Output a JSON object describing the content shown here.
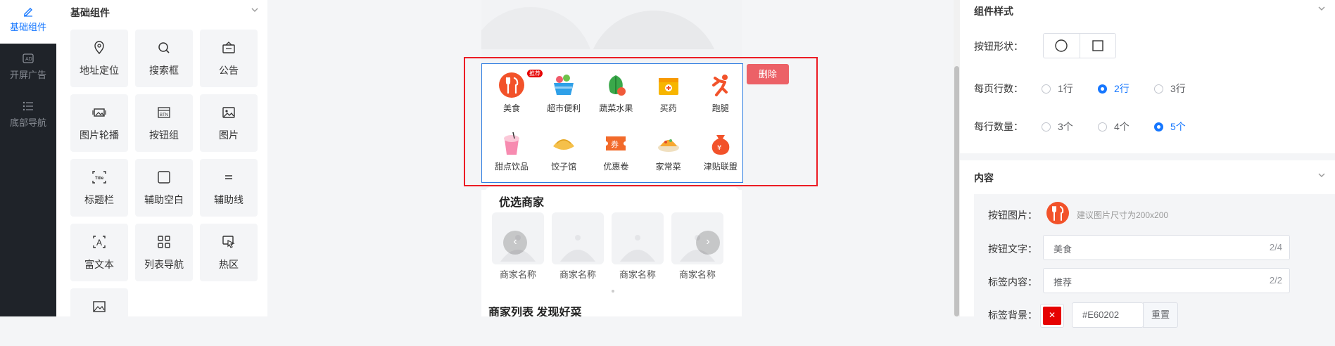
{
  "rail": {
    "items": [
      {
        "label": "基础组件",
        "icon": "edit-icon"
      },
      {
        "label": "开屏广告",
        "icon": "ad-icon"
      },
      {
        "label": "底部导航",
        "icon": "list-icon"
      }
    ]
  },
  "palette": {
    "title": "基础组件",
    "items": [
      {
        "label": "地址定位",
        "icon": "location-pin-icon"
      },
      {
        "label": "搜索框",
        "icon": "search-icon"
      },
      {
        "label": "公告",
        "icon": "notice-icon"
      },
      {
        "label": "图片轮播",
        "icon": "image-carousel-icon"
      },
      {
        "label": "按钮组",
        "icon": "button-group-icon"
      },
      {
        "label": "图片",
        "icon": "image-icon"
      },
      {
        "label": "标题栏",
        "icon": "title-bar-icon"
      },
      {
        "label": "辅助空白",
        "icon": "blank-space-icon"
      },
      {
        "label": "辅助线",
        "icon": "divider-line-icon"
      },
      {
        "label": "富文本",
        "icon": "rich-text-icon"
      },
      {
        "label": "列表导航",
        "icon": "list-nav-icon"
      },
      {
        "label": "热区",
        "icon": "hotspot-icon"
      },
      {
        "label": "",
        "icon": "picture-icon"
      }
    ]
  },
  "canvas": {
    "delete_label": "删除",
    "nav": [
      {
        "label": "美食",
        "badge": "推荐",
        "icon": "food-icon",
        "color": "#f2522a"
      },
      {
        "label": "超市便利",
        "icon": "basket-icon",
        "color": "#2fa0e8"
      },
      {
        "label": "蔬菜水果",
        "icon": "vegetable-icon",
        "color": "#3aa84a"
      },
      {
        "label": "买药",
        "icon": "medicine-box-icon",
        "color": "#f7b500"
      },
      {
        "label": "跑腿",
        "icon": "runner-icon",
        "color": "#f2522a"
      },
      {
        "label": "甜点饮品",
        "icon": "drink-icon",
        "color": "#f78bb0"
      },
      {
        "label": "饺子馆",
        "icon": "dumpling-icon",
        "color": "#f5c04a"
      },
      {
        "label": "优惠卷",
        "icon": "coupon-icon",
        "color": "#f26a2a"
      },
      {
        "label": "家常菜",
        "icon": "dish-icon",
        "color": "#f7a830"
      },
      {
        "label": "津贴联盟",
        "icon": "money-bag-icon",
        "color": "#f2522a"
      }
    ],
    "merchants": {
      "title": "优选商家",
      "names": [
        "商家名称",
        "商家名称",
        "商家名称",
        "商家名称"
      ]
    },
    "list_title": "商家列表 发现好菜"
  },
  "settings": {
    "style_title": "组件样式",
    "shape_label": "按钮形状：",
    "rows_label": "每页行数：",
    "rows_options": [
      "1行",
      "2行",
      "3行"
    ],
    "rows_selected": "2行",
    "per_row_label": "每行数量：",
    "per_row_options": [
      "3个",
      "4个",
      "5个"
    ],
    "per_row_selected": "5个",
    "content_title": "内容",
    "image_label": "按钮图片：",
    "image_hint": "建议图片尺寸为200x200",
    "text_label": "按钮文字：",
    "text_value": "美食",
    "text_count": "2/4",
    "tag_label": "标签内容：",
    "tag_value": "推荐",
    "tag_count": "2/2",
    "tag_bg_label": "标签背景：",
    "tag_bg_value": "#E60202",
    "reset_label": "重置"
  },
  "colors": {
    "accent": "#1677ff",
    "selection": "#ec1c24",
    "delete": "#ec6167",
    "tag_bg": "#E60202"
  }
}
